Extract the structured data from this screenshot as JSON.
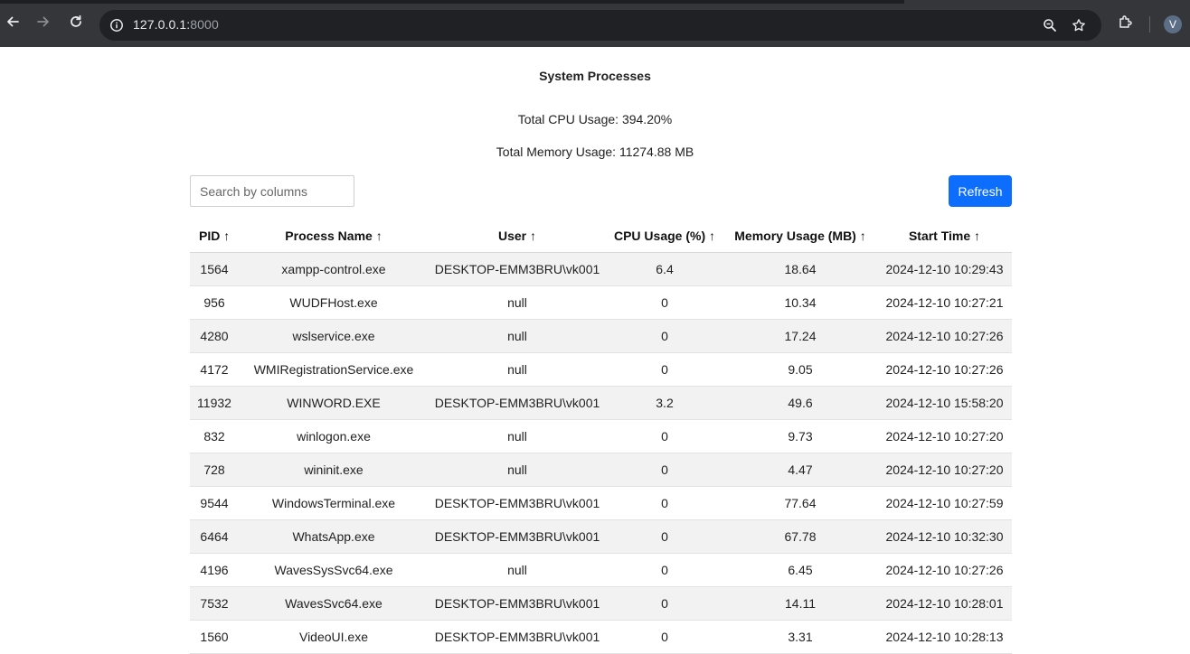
{
  "browser": {
    "url_host": "127.0.0.1:",
    "url_port": "8000",
    "profile_initial": "V"
  },
  "page": {
    "title": "System Processes",
    "total_cpu": "Total CPU Usage: 394.20%",
    "total_memory": "Total Memory Usage: 11274.88 MB",
    "search_placeholder": "Search by columns",
    "refresh_label": "Refresh"
  },
  "table": {
    "headers": [
      "PID ↑",
      "Process Name ↑",
      "User ↑",
      "CPU Usage (%) ↑",
      "Memory Usage (MB) ↑",
      "Start Time ↑"
    ],
    "rows": [
      [
        "1564",
        "xampp-control.exe",
        "DESKTOP-EMM3BRU\\vk001",
        "6.4",
        "18.64",
        "2024-12-10 10:29:43"
      ],
      [
        "956",
        "WUDFHost.exe",
        "null",
        "0",
        "10.34",
        "2024-12-10 10:27:21"
      ],
      [
        "4280",
        "wslservice.exe",
        "null",
        "0",
        "17.24",
        "2024-12-10 10:27:26"
      ],
      [
        "4172",
        "WMIRegistrationService.exe",
        "null",
        "0",
        "9.05",
        "2024-12-10 10:27:26"
      ],
      [
        "11932",
        "WINWORD.EXE",
        "DESKTOP-EMM3BRU\\vk001",
        "3.2",
        "49.6",
        "2024-12-10 15:58:20"
      ],
      [
        "832",
        "winlogon.exe",
        "null",
        "0",
        "9.73",
        "2024-12-10 10:27:20"
      ],
      [
        "728",
        "wininit.exe",
        "null",
        "0",
        "4.47",
        "2024-12-10 10:27:20"
      ],
      [
        "9544",
        "WindowsTerminal.exe",
        "DESKTOP-EMM3BRU\\vk001",
        "0",
        "77.64",
        "2024-12-10 10:27:59"
      ],
      [
        "6464",
        "WhatsApp.exe",
        "DESKTOP-EMM3BRU\\vk001",
        "0",
        "67.78",
        "2024-12-10 10:32:30"
      ],
      [
        "4196",
        "WavesSysSvc64.exe",
        "null",
        "0",
        "6.45",
        "2024-12-10 10:27:26"
      ],
      [
        "7532",
        "WavesSvc64.exe",
        "DESKTOP-EMM3BRU\\vk001",
        "0",
        "14.11",
        "2024-12-10 10:28:01"
      ],
      [
        "1560",
        "VideoUI.exe",
        "DESKTOP-EMM3BRU\\vk001",
        "0",
        "3.31",
        "2024-12-10 10:28:13"
      ]
    ]
  }
}
